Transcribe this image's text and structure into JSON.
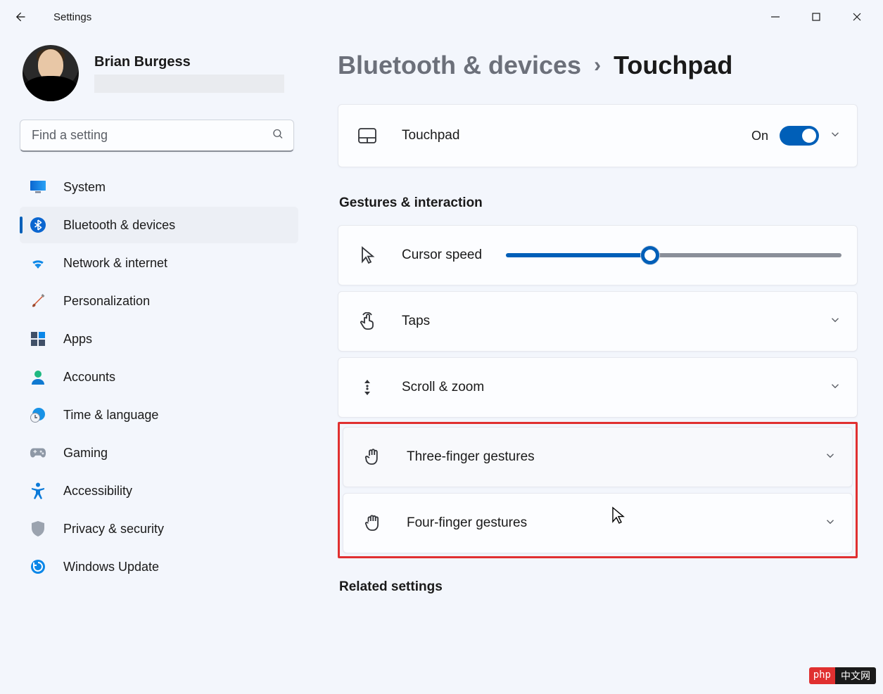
{
  "app": {
    "title": "Settings"
  },
  "user": {
    "name": "Brian Burgess"
  },
  "search": {
    "placeholder": "Find a setting"
  },
  "nav": {
    "items": [
      {
        "id": "system",
        "label": "System"
      },
      {
        "id": "bluetooth",
        "label": "Bluetooth & devices"
      },
      {
        "id": "network",
        "label": "Network & internet"
      },
      {
        "id": "personalization",
        "label": "Personalization"
      },
      {
        "id": "apps",
        "label": "Apps"
      },
      {
        "id": "accounts",
        "label": "Accounts"
      },
      {
        "id": "time",
        "label": "Time & language"
      },
      {
        "id": "gaming",
        "label": "Gaming"
      },
      {
        "id": "accessibility",
        "label": "Accessibility"
      },
      {
        "id": "privacy",
        "label": "Privacy & security"
      },
      {
        "id": "update",
        "label": "Windows Update"
      }
    ]
  },
  "breadcrumb": {
    "parent": "Bluetooth & devices",
    "current": "Touchpad"
  },
  "touchpad_card": {
    "label": "Touchpad",
    "state_label": "On"
  },
  "sections": {
    "gestures_title": "Gestures & interaction",
    "related_title": "Related settings"
  },
  "rows": {
    "cursor_speed": "Cursor speed",
    "taps": "Taps",
    "scroll_zoom": "Scroll & zoom",
    "three_finger": "Three-finger gestures",
    "four_finger": "Four-finger gestures"
  },
  "slider": {
    "value_pct": 43
  },
  "watermark": {
    "left": "php",
    "right": "中文网"
  },
  "colors": {
    "accent": "#005fb8",
    "highlight": "#e03030"
  }
}
